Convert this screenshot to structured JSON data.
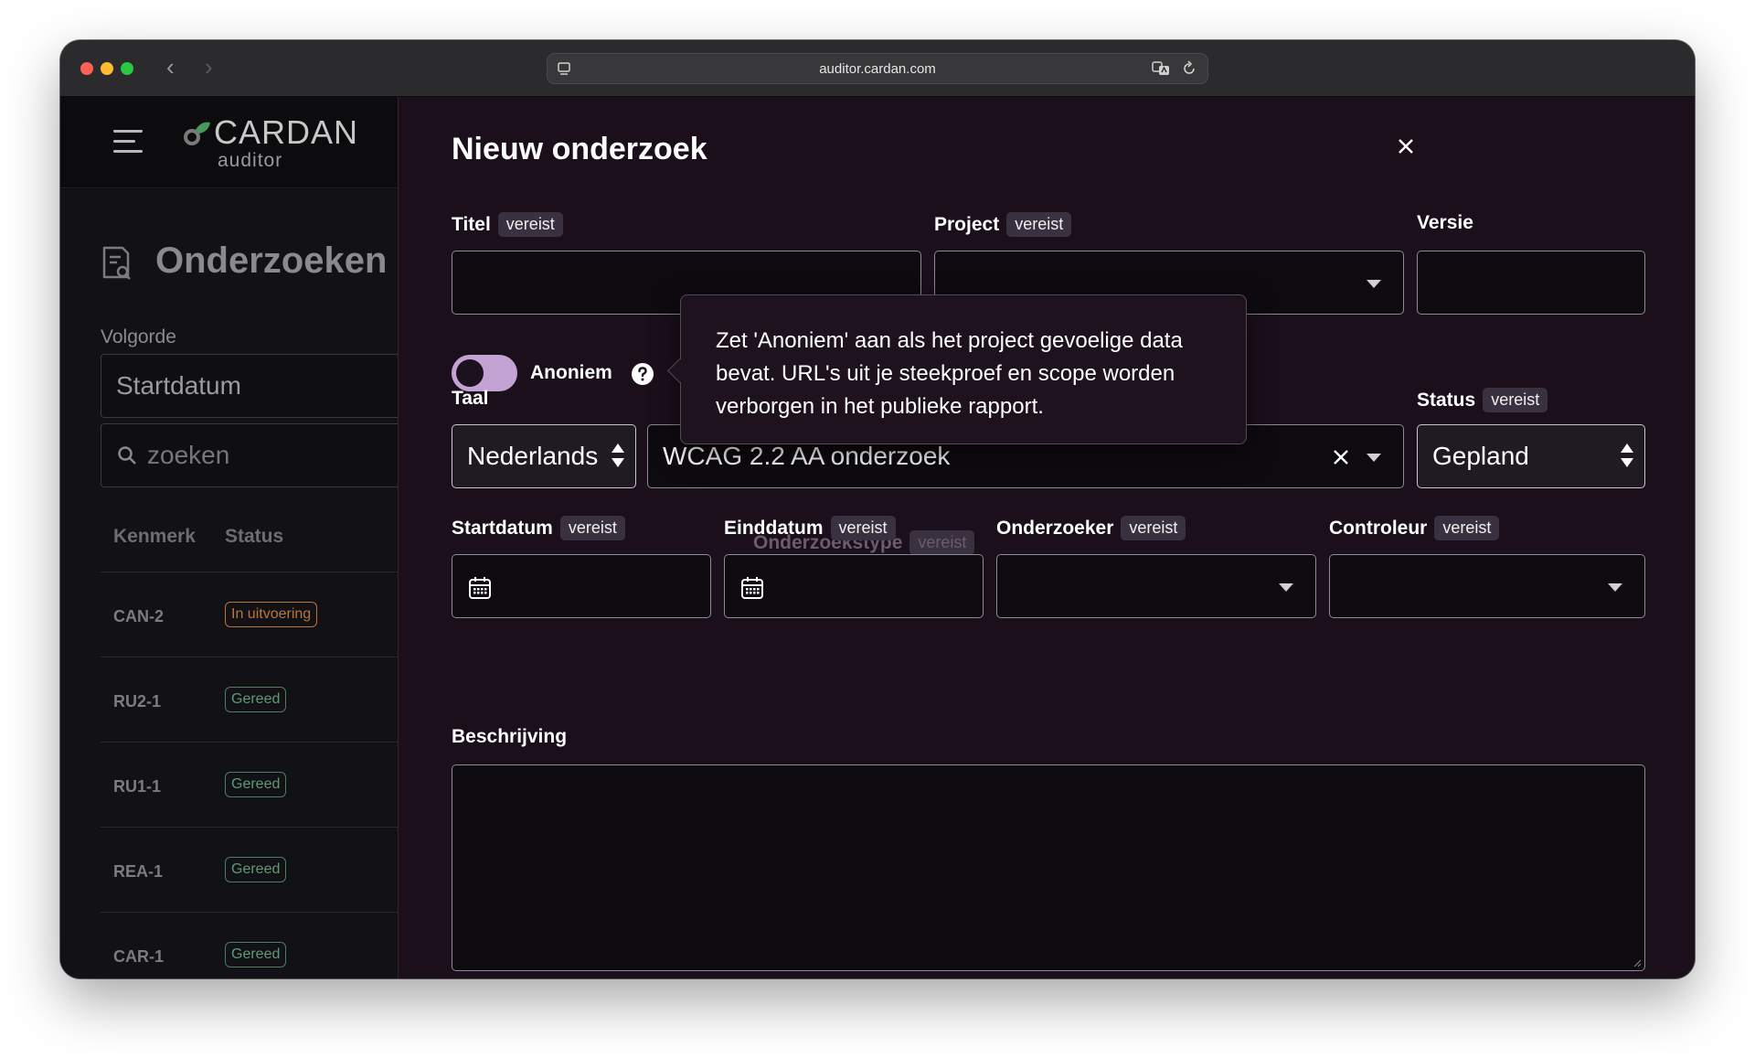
{
  "browser": {
    "url": "auditor.cardan.com",
    "back_glyph": "‹",
    "forward_glyph": "›"
  },
  "sidebar": {
    "logo": {
      "name": "CARDAN",
      "sub": "auditor",
      "mark_color": "#4a9a57"
    },
    "page_title": "Onderzoeken",
    "sort_label": "Volgorde",
    "sort_value": "Startdatum",
    "search_placeholder": "zoeken",
    "columns": {
      "kenmerk": "Kenmerk",
      "status": "Status"
    },
    "rows": [
      {
        "id": "CAN-2",
        "status": "In uitvoering",
        "kind": "progress"
      },
      {
        "id": "RU2-1",
        "status": "Gereed",
        "kind": "done"
      },
      {
        "id": "RU1-1",
        "status": "Gereed",
        "kind": "done"
      },
      {
        "id": "REA-1",
        "status": "Gereed",
        "kind": "done"
      },
      {
        "id": "CAR-1",
        "status": "Gereed",
        "kind": "done"
      }
    ]
  },
  "modal": {
    "title": "Nieuw onderzoek",
    "required_badge": "vereist",
    "fields": {
      "titel": {
        "label": "Titel",
        "value": ""
      },
      "project": {
        "label": "Project",
        "value": ""
      },
      "versie": {
        "label": "Versie",
        "value": ""
      },
      "anoniem": {
        "label": "Anoniem",
        "on": false
      },
      "taal": {
        "label": "Taal",
        "value": "Nederlands"
      },
      "onderzoekstype": {
        "label": "Onderzoekstype",
        "value": "WCAG 2.2 AA onderzoek"
      },
      "status": {
        "label": "Status",
        "value": "Gepland"
      },
      "startdatum": {
        "label": "Startdatum",
        "value": ""
      },
      "einddatum": {
        "label": "Einddatum",
        "value": ""
      },
      "onderzoeker": {
        "label": "Onderzoeker",
        "value": ""
      },
      "controleur": {
        "label": "Controleur",
        "value": ""
      },
      "beschrijving": {
        "label": "Beschrijving",
        "value": ""
      }
    },
    "tooltip": "Zet 'Anoniem' aan als het project gevoelige data bevat. URL's uit je steekproef en scope worden verborgen in het publieke rapport.",
    "accent_color": "#c48ee0"
  }
}
